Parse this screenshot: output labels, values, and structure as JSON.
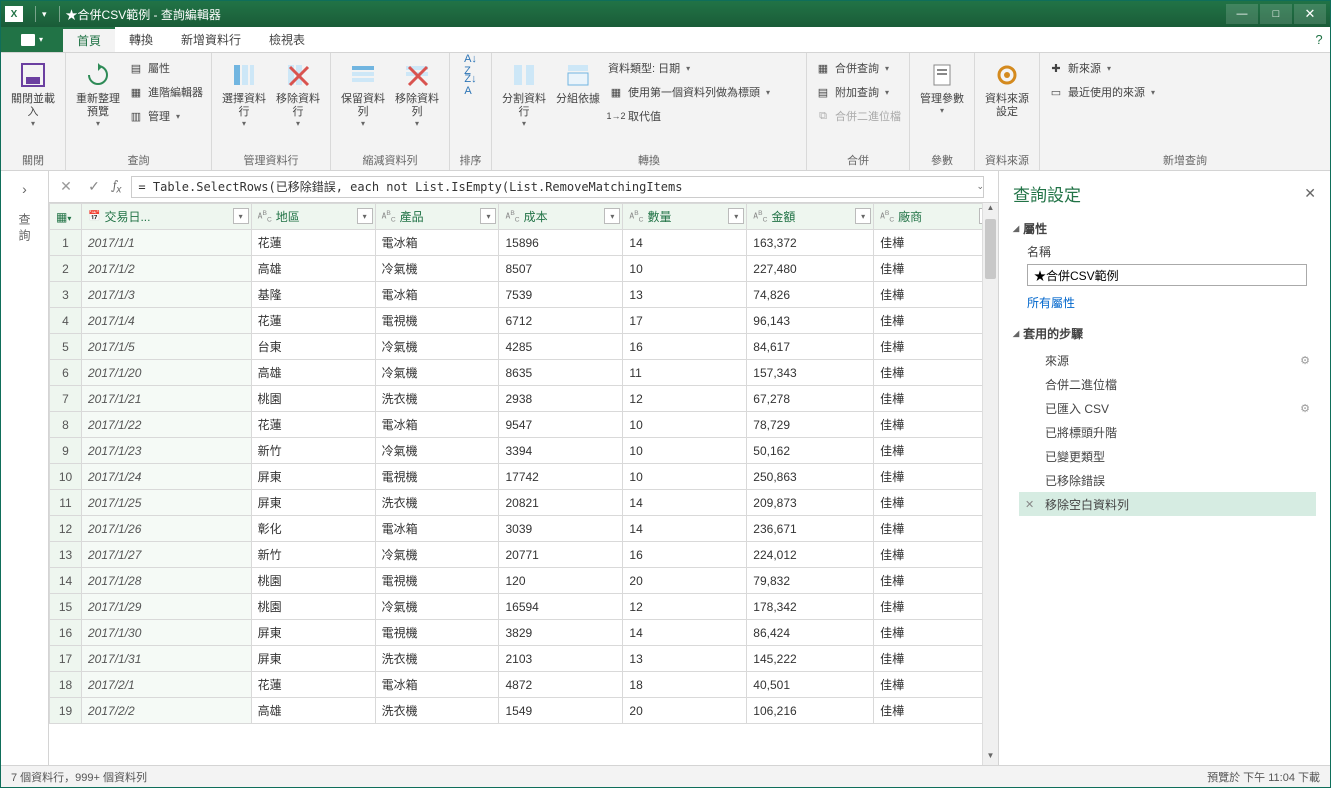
{
  "titlebar": {
    "app_icon": "X",
    "title": "★合併CSV範例 - 查詢編輯器"
  },
  "menubar": {
    "file_dd": "▾",
    "tabs": [
      "首頁",
      "轉換",
      "新增資料行",
      "檢視表"
    ]
  },
  "ribbon": {
    "close": {
      "big": "關閉並載入",
      "group": "關閉"
    },
    "query": {
      "refresh": "重新整理預覽",
      "props": "屬性",
      "adv": "進階編輯器",
      "manage": "管理",
      "group": "查詢"
    },
    "cols": {
      "choose": "選擇資料行",
      "remove": "移除資料行",
      "group": "管理資料行"
    },
    "rows": {
      "keep": "保留資料列",
      "remove": "移除資料列",
      "group": "縮減資料列"
    },
    "sort": {
      "group": "排序"
    },
    "split": {
      "split": "分割資料行",
      "group_by": "分組依據"
    },
    "trans": {
      "dtype": "資料類型: 日期",
      "firstrow": "使用第一個資料列做為標頭",
      "replace": "取代值",
      "group": "轉換"
    },
    "merge": {
      "merge": "合併查詢",
      "append": "附加查詢",
      "bin": "合併二進位檔",
      "group": "合併"
    },
    "param": {
      "big": "管理參數",
      "group": "參數"
    },
    "src": {
      "big": "資料來源設定",
      "group": "資料來源"
    },
    "newq": {
      "new": "新來源",
      "recent": "最近使用的來源",
      "group": "新增查詢"
    }
  },
  "formula": "= Table.SelectRows(已移除錯誤, each not List.IsEmpty(List.RemoveMatchingItems",
  "columns": [
    {
      "name": "交易日...",
      "type": "date"
    },
    {
      "name": "地區",
      "type": "abc"
    },
    {
      "name": "產品",
      "type": "abc"
    },
    {
      "name": "成本",
      "type": "abc"
    },
    {
      "name": "數量",
      "type": "abc"
    },
    {
      "name": "金額",
      "type": "abc"
    },
    {
      "name": "廠商",
      "type": "abc"
    }
  ],
  "rows": [
    [
      "2017/1/1",
      "花蓮",
      "電冰箱",
      "15896",
      "14",
      "163,372",
      "佳樺"
    ],
    [
      "2017/1/2",
      "高雄",
      "冷氣機",
      "8507",
      "10",
      "227,480",
      "佳樺"
    ],
    [
      "2017/1/3",
      "基隆",
      "電冰箱",
      "7539",
      "13",
      "74,826",
      "佳樺"
    ],
    [
      "2017/1/4",
      "花蓮",
      "電視機",
      "6712",
      "17",
      "96,143",
      "佳樺"
    ],
    [
      "2017/1/5",
      "台東",
      "冷氣機",
      "4285",
      "16",
      "84,617",
      "佳樺"
    ],
    [
      "2017/1/20",
      "高雄",
      "冷氣機",
      "8635",
      "11",
      "157,343",
      "佳樺"
    ],
    [
      "2017/1/21",
      "桃園",
      "洗衣機",
      "2938",
      "12",
      "67,278",
      "佳樺"
    ],
    [
      "2017/1/22",
      "花蓮",
      "電冰箱",
      "9547",
      "10",
      "78,729",
      "佳樺"
    ],
    [
      "2017/1/23",
      "新竹",
      "冷氣機",
      "3394",
      "10",
      "50,162",
      "佳樺"
    ],
    [
      "2017/1/24",
      "屏東",
      "電視機",
      "17742",
      "10",
      "250,863",
      "佳樺"
    ],
    [
      "2017/1/25",
      "屏東",
      "洗衣機",
      "20821",
      "14",
      "209,873",
      "佳樺"
    ],
    [
      "2017/1/26",
      "彰化",
      "電冰箱",
      "3039",
      "14",
      "236,671",
      "佳樺"
    ],
    [
      "2017/1/27",
      "新竹",
      "冷氣機",
      "20771",
      "16",
      "224,012",
      "佳樺"
    ],
    [
      "2017/1/28",
      "桃園",
      "電視機",
      "120",
      "20",
      "79,832",
      "佳樺"
    ],
    [
      "2017/1/29",
      "桃園",
      "冷氣機",
      "16594",
      "12",
      "178,342",
      "佳樺"
    ],
    [
      "2017/1/30",
      "屏東",
      "電視機",
      "3829",
      "14",
      "86,424",
      "佳樺"
    ],
    [
      "2017/1/31",
      "屏東",
      "洗衣機",
      "2103",
      "13",
      "145,222",
      "佳樺"
    ],
    [
      "2017/2/1",
      "花蓮",
      "電冰箱",
      "4872",
      "18",
      "40,501",
      "佳樺"
    ],
    [
      "2017/2/2",
      "高雄",
      "洗衣機",
      "1549",
      "20",
      "106,216",
      "佳樺"
    ]
  ],
  "rpanel": {
    "title": "查詢設定",
    "props_hdr": "屬性",
    "name_label": "名稱",
    "name_value": "★合併CSV範例",
    "all_props": "所有屬性",
    "steps_hdr": "套用的步驟",
    "steps": [
      "來源",
      "合併二進位檔",
      "已匯入 CSV",
      "已將標頭升階",
      "已變更類型",
      "已移除錯誤",
      "移除空白資料列"
    ],
    "selected_step": 6,
    "gears": [
      0,
      2
    ]
  },
  "nav_label": "查詢",
  "status": {
    "left": "7 個資料行，999+ 個資料列",
    "right": "預覽於 下午 11:04 下載"
  }
}
